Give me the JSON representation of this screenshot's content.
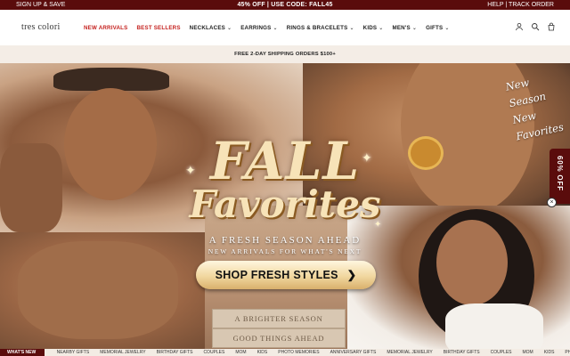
{
  "topbar": {
    "left": "SIGN UP & SAVE",
    "center": "45% OFF | USE CODE: FALL45",
    "right": "HELP | TRACK ORDER"
  },
  "header": {
    "logo": "tres colori",
    "nav": [
      {
        "label": "NEW ARRIVALS",
        "red": true,
        "dropdown": false
      },
      {
        "label": "BEST SELLERS",
        "red": true,
        "dropdown": false
      },
      {
        "label": "NECKLACES",
        "red": false,
        "dropdown": true
      },
      {
        "label": "EARRINGS",
        "red": false,
        "dropdown": true
      },
      {
        "label": "RINGS & BRACELETS",
        "red": false,
        "dropdown": true
      },
      {
        "label": "KIDS",
        "red": false,
        "dropdown": true
      },
      {
        "label": "MEN'S",
        "red": false,
        "dropdown": true
      },
      {
        "label": "GIFTS",
        "red": false,
        "dropdown": true
      }
    ],
    "icons": [
      "account-icon",
      "search-icon",
      "cart-icon"
    ]
  },
  "shipbar": {
    "text": "FREE 2-DAY SHIPPING ORDERS $100+"
  },
  "hero": {
    "title_line1": "FALL",
    "title_line2": "Favorites",
    "tagline1": "A FRESH SEASON AHEAD",
    "tagline2": "NEW ARRIVALS FOR WHAT'S NEXT",
    "cta": "SHOP FRESH STYLES",
    "script_lines": [
      "New",
      "Season",
      "New",
      "Favorites"
    ],
    "books": [
      "A BRIGHTER SEASON",
      "GOOD THINGS AHEAD"
    ]
  },
  "offtab": {
    "label": "60% OFF",
    "close": "×"
  },
  "categories": {
    "first": "WHAT'S NEW",
    "items": [
      "NEARBY GIFTS",
      "MEMORIAL JEWELRY",
      "BIRTHDAY GIFTS",
      "COUPLES",
      "MOM",
      "KIDS",
      "PHOTO MEMORIES",
      "ANNIVERSARY GIFTS",
      "MEMORIAL JEWELRY",
      "BIRTHDAY GIFTS",
      "COUPLES",
      "MOM",
      "KIDS",
      "PHOTO MEMORIES"
    ]
  },
  "colors": {
    "brand": "#5a0c0c",
    "sale_red": "#c5221f",
    "cream": "#f4ede6",
    "gold": "#f1d79f"
  }
}
